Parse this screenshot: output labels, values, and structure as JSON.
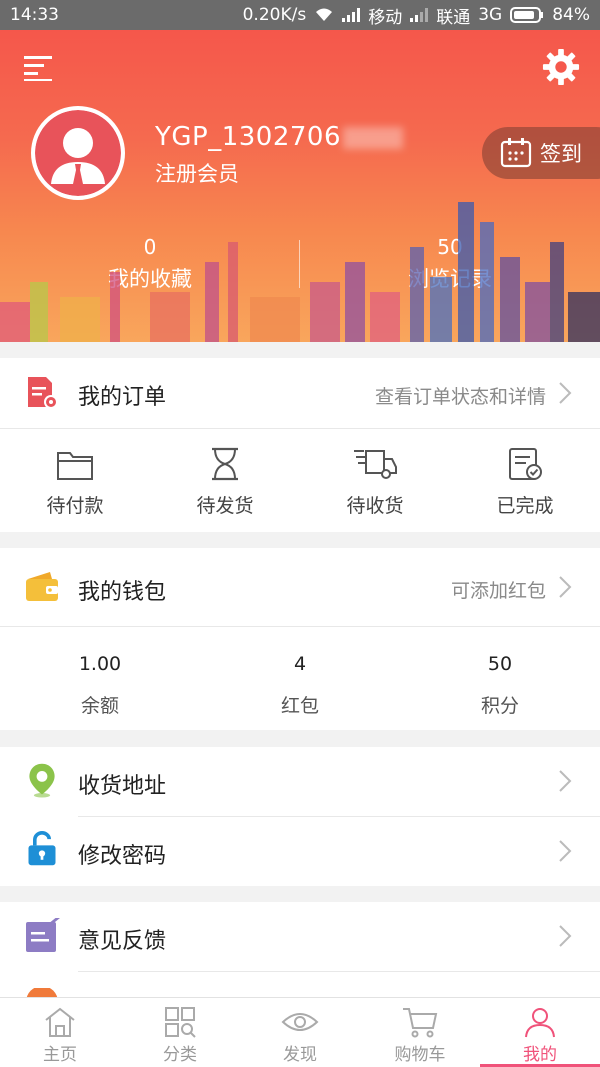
{
  "status_bar": {
    "time": "14:33",
    "speed": "0.20K/s",
    "carrier1": "移动",
    "carrier2": "联通",
    "network": "3G",
    "battery": "84%"
  },
  "profile": {
    "username": "YGP_1302706",
    "member_level": "注册会员",
    "signin_label": "签到",
    "stats": [
      {
        "value": "0",
        "label": "我的收藏"
      },
      {
        "value": "50",
        "label": "浏览记录"
      }
    ]
  },
  "orders": {
    "title": "我的订单",
    "hint": "查看订单状态和详情",
    "items": [
      {
        "label": "待付款",
        "icon": "folder-icon"
      },
      {
        "label": "待发货",
        "icon": "hourglass-icon"
      },
      {
        "label": "待收货",
        "icon": "truck-icon"
      },
      {
        "label": "已完成",
        "icon": "checklist-icon"
      }
    ]
  },
  "wallet": {
    "title": "我的钱包",
    "hint": "可添加红包",
    "items": [
      {
        "value": "1.00",
        "label": "余额"
      },
      {
        "value": "4",
        "label": "红包"
      },
      {
        "value": "50",
        "label": "积分"
      }
    ]
  },
  "menu": {
    "address": "收货地址",
    "password": "修改密码",
    "feedback": "意见反馈"
  },
  "bottom_nav": {
    "items": [
      {
        "label": "主页",
        "icon": "home-icon"
      },
      {
        "label": "分类",
        "icon": "category-icon"
      },
      {
        "label": "发现",
        "icon": "eye-icon"
      },
      {
        "label": "购物车",
        "icon": "cart-icon"
      },
      {
        "label": "我的",
        "icon": "user-icon"
      }
    ],
    "active_index": 4
  },
  "colors": {
    "accent": "#f0527a",
    "header_top": "#f5574b",
    "header_bottom": "#f9a65c",
    "order_icon": "#e8535a",
    "wallet_icon": "#f4bf3a",
    "address_icon": "#8bc34a",
    "password_icon": "#1e8fd6",
    "feedback_icon": "#8d7cc4"
  }
}
